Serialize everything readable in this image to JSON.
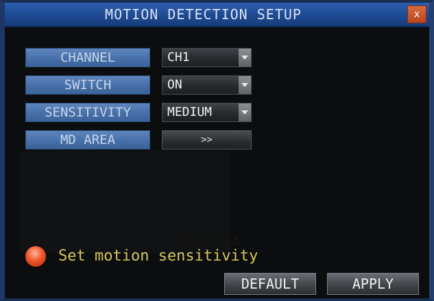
{
  "window": {
    "title": "MOTION DETECTION SETUP",
    "close_glyph": "x"
  },
  "settings": [
    {
      "label": "CHANNEL",
      "value": "CH1"
    },
    {
      "label": "SWITCH",
      "value": "ON"
    },
    {
      "label": "SENSITIVITY",
      "value": "MEDIUM"
    }
  ],
  "md_area": {
    "label": "MD AREA",
    "button": ">>"
  },
  "hint": {
    "icon": "red-circle-icon",
    "text": "Set motion sensitivity"
  },
  "caption": "Fig. 2-44",
  "footer": {
    "default_label": "DEFAULT",
    "apply_label": "APPLY"
  },
  "colors": {
    "title_bar": "#1e4a92",
    "label_button": "#4670a9",
    "hint_text": "#d6c75c",
    "hint_icon": "#f0552c"
  }
}
